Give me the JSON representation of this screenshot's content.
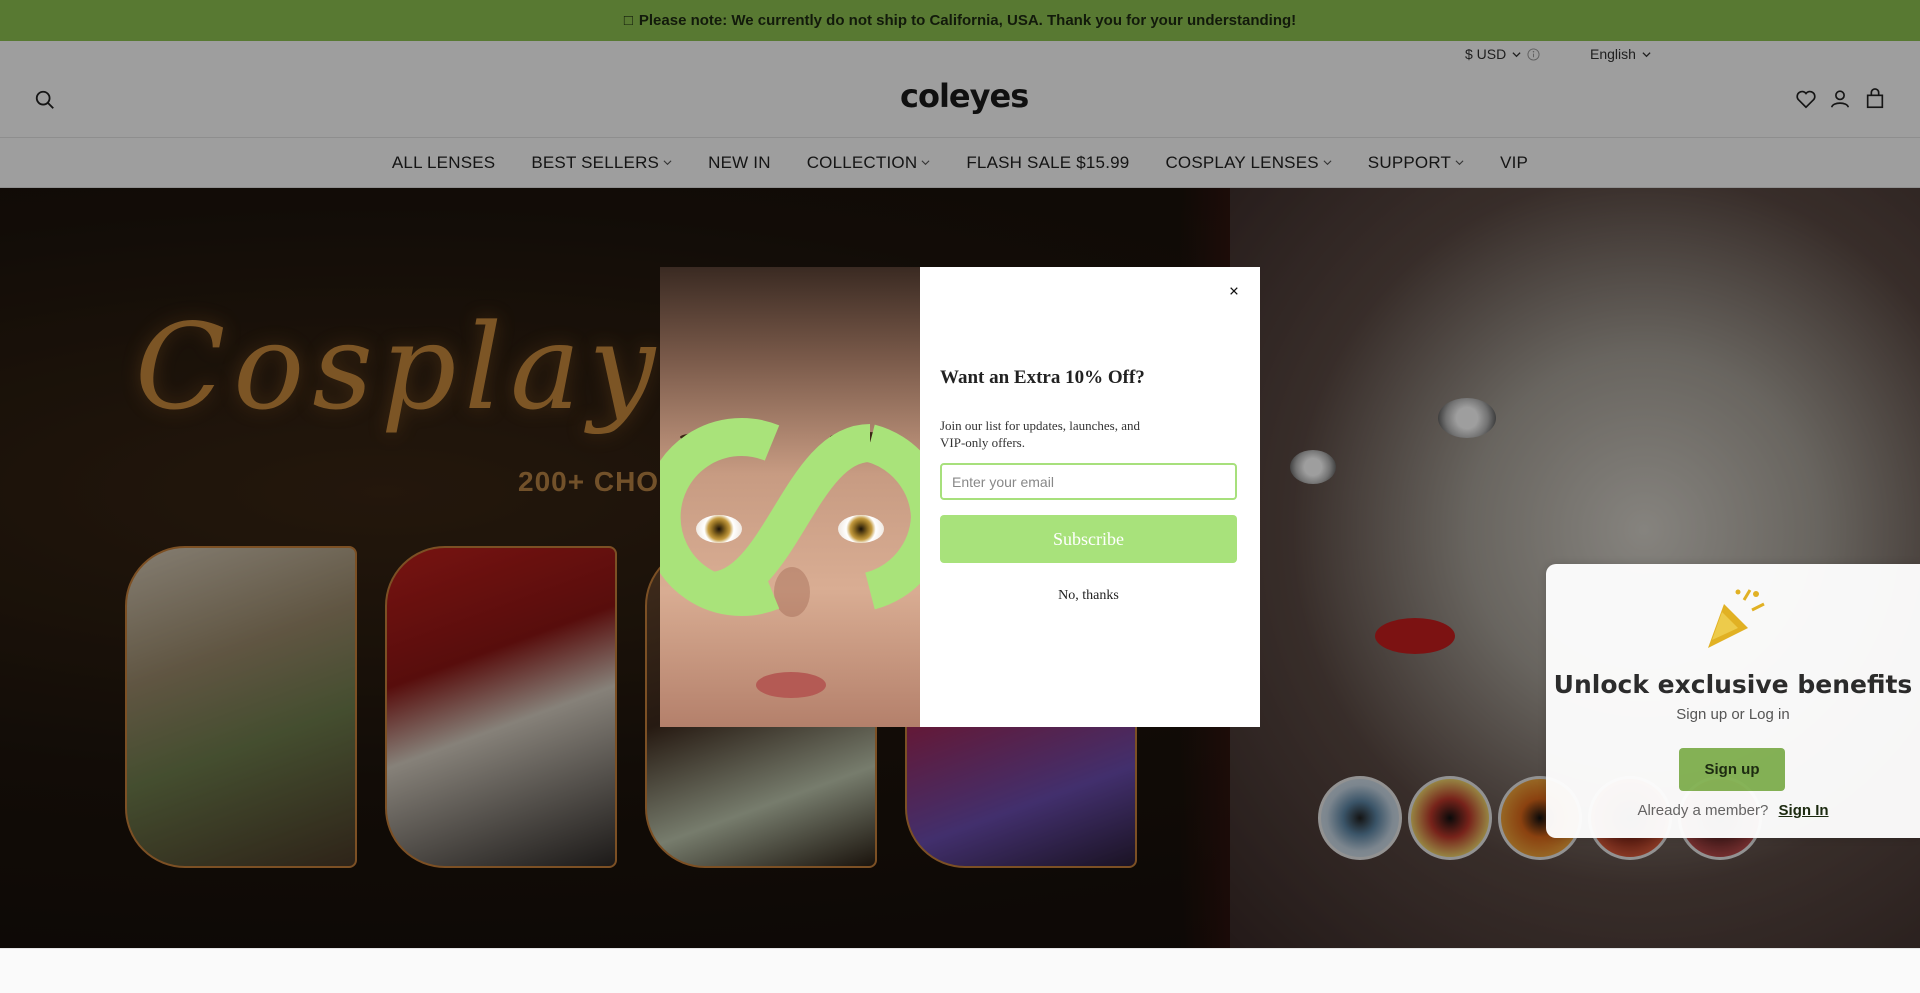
{
  "announcement": {
    "icon": "megaphone-icon",
    "text": "Please note: We currently do not ship to California, USA. Thank you for your understanding!"
  },
  "header": {
    "currency": "$ USD",
    "language": "English",
    "logo": "coleyes",
    "icons": [
      "search-icon",
      "heart-icon",
      "account-icon",
      "bag-icon"
    ]
  },
  "nav": {
    "items": [
      {
        "label": "ALL LENSES",
        "dropdown": false
      },
      {
        "label": "BEST SELLERS",
        "dropdown": true
      },
      {
        "label": "NEW IN",
        "dropdown": false
      },
      {
        "label": "COLLECTION",
        "dropdown": true
      },
      {
        "label": "FLASH SALE $15.99",
        "dropdown": false
      },
      {
        "label": "COSPLAY LENSES",
        "dropdown": true
      },
      {
        "label": "SUPPORT",
        "dropdown": true
      },
      {
        "label": "VIP",
        "dropdown": false
      }
    ]
  },
  "hero": {
    "title": "Cosplay Co",
    "subtitle": "200+ CHOIC"
  },
  "modal": {
    "close": "×",
    "title": "Want an Extra 10% Off?",
    "text": "Join our list for updates, launches, and VIP-only offers.",
    "email_placeholder": "Enter your email",
    "subscribe_label": "Subscribe",
    "decline_label": "No, thanks",
    "accent_color": "#a8e27b"
  },
  "rewards_panel": {
    "title": "Unlock exclusive benefits",
    "subtitle": "Sign up or Log in",
    "signup_label": "Sign up",
    "member_text": "Already a member?",
    "signin_label": "Sign In"
  },
  "colors": {
    "announcement_bg": "#8fc452",
    "signup_bg": "#86b556"
  }
}
